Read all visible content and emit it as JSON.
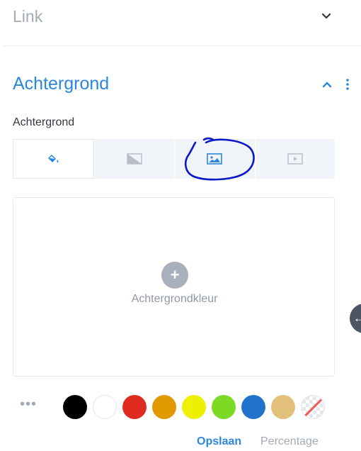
{
  "link_section": {
    "title": "Link"
  },
  "background_section": {
    "title": "Achtergrond",
    "field_label": "Achtergrond",
    "tabs": [
      {
        "icon": "paint-bucket-icon",
        "active": true
      },
      {
        "icon": "gradient-icon",
        "active": false
      },
      {
        "icon": "image-icon",
        "active": false
      },
      {
        "icon": "video-icon",
        "active": false
      }
    ],
    "preview": {
      "add_icon": "+",
      "label": "Achtergrondkleur"
    }
  },
  "palette": {
    "more_label": "•••",
    "swatches": [
      "#000000",
      "#ffffff",
      "#e02b20",
      "#e09900",
      "#edf000",
      "#7cda24",
      "#2172cc",
      "#e2c07a",
      "transparent"
    ]
  },
  "actions": {
    "save_label": "Opslaan",
    "percentage_label": "Percentage"
  },
  "colors": {
    "accent": "#2b87da",
    "muted": "#a3aab5",
    "annotation": "#0a18c8"
  }
}
